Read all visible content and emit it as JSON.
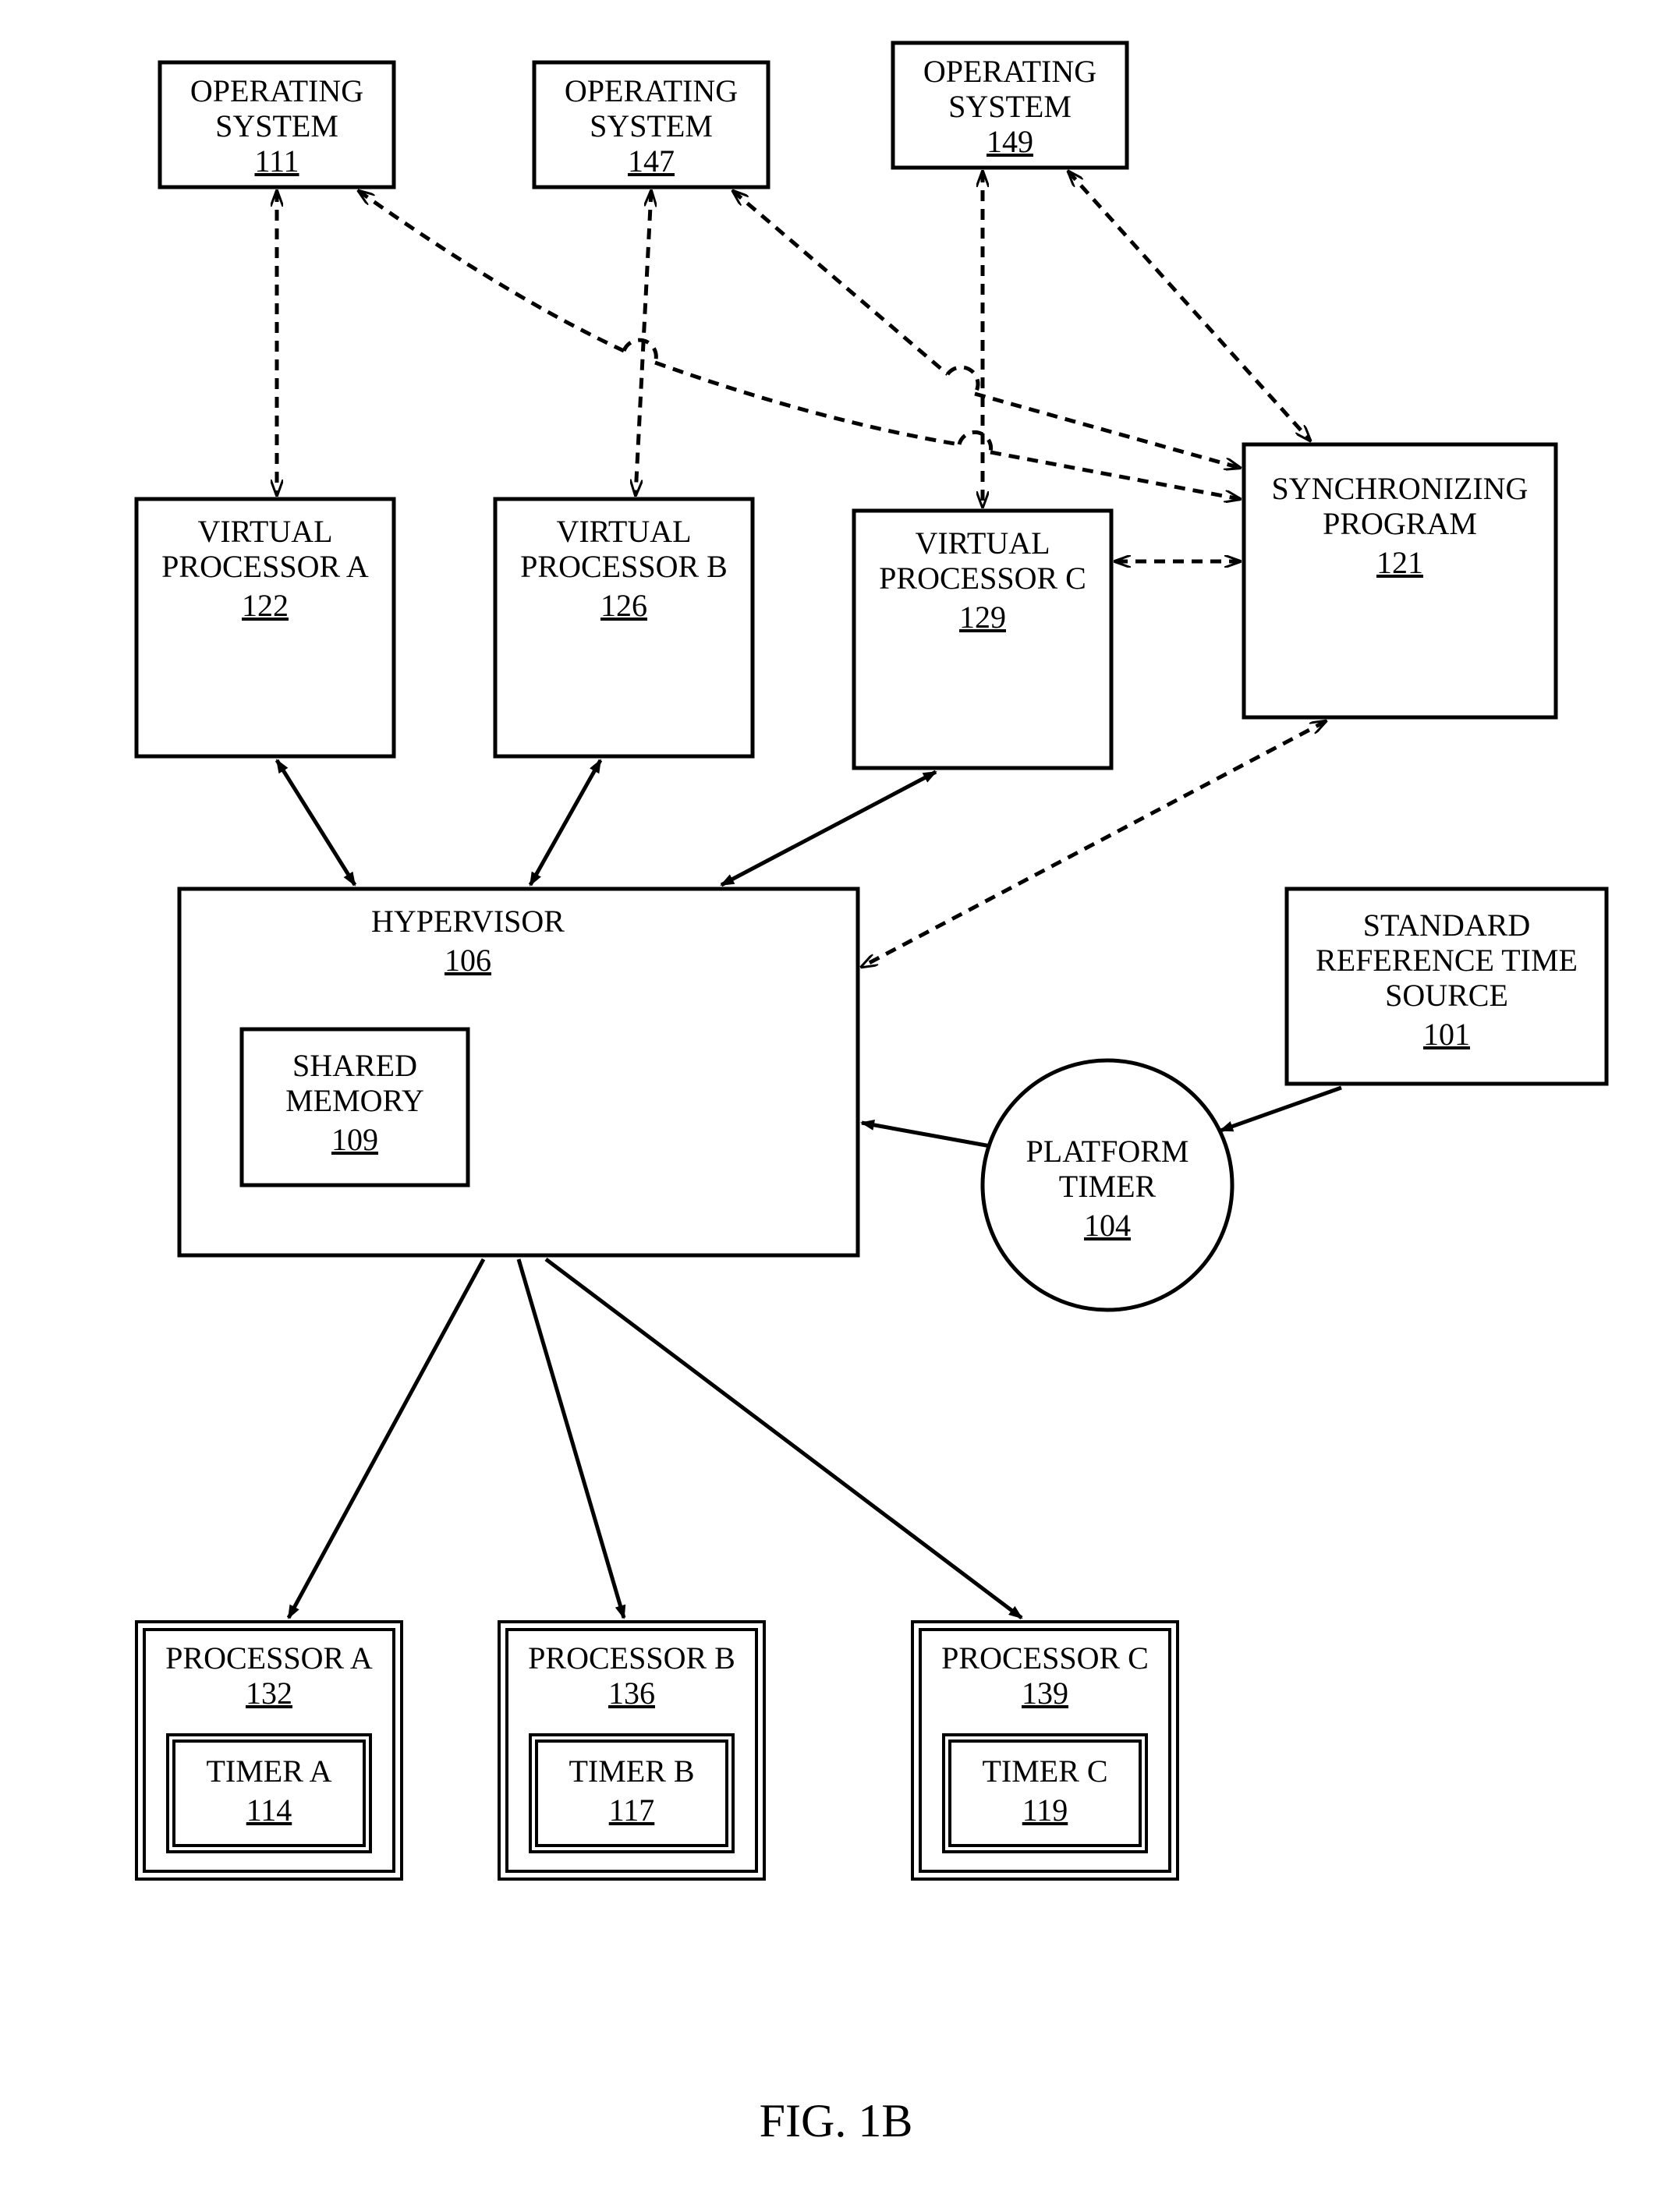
{
  "figure_label": "FIG. 1B",
  "os": [
    {
      "label": "OPERATING",
      "label2": "SYSTEM",
      "num": "111"
    },
    {
      "label": "OPERATING",
      "label2": "SYSTEM",
      "num": "147"
    },
    {
      "label": "OPERATING",
      "label2": "SYSTEM",
      "num": "149"
    }
  ],
  "vproc": [
    {
      "label": "VIRTUAL",
      "label2": "PROCESSOR A",
      "num": "122"
    },
    {
      "label": "VIRTUAL",
      "label2": "PROCESSOR B",
      "num": "126"
    },
    {
      "label": "VIRTUAL",
      "label2": "PROCESSOR C",
      "num": "129"
    }
  ],
  "sync": {
    "label": "SYNCHRONIZING",
    "label2": "PROGRAM",
    "num": "121"
  },
  "hv": {
    "label": "HYPERVISOR",
    "num": "106"
  },
  "shmem": {
    "label": "SHARED",
    "label2": "MEMORY",
    "num": "109"
  },
  "ptimer": {
    "label": "PLATFORM",
    "label2": "TIMER",
    "num": "104"
  },
  "ref": {
    "label": "STANDARD",
    "label2": "REFERENCE TIME",
    "label3": "SOURCE",
    "num": "101"
  },
  "proc": [
    {
      "label": "PROCESSOR A",
      "num": "132",
      "tlabel": "TIMER A",
      "tnum": "114"
    },
    {
      "label": "PROCESSOR B",
      "num": "136",
      "tlabel": "TIMER B",
      "tnum": "117"
    },
    {
      "label": "PROCESSOR C",
      "num": "139",
      "tlabel": "TIMER C",
      "tnum": "119"
    }
  ]
}
